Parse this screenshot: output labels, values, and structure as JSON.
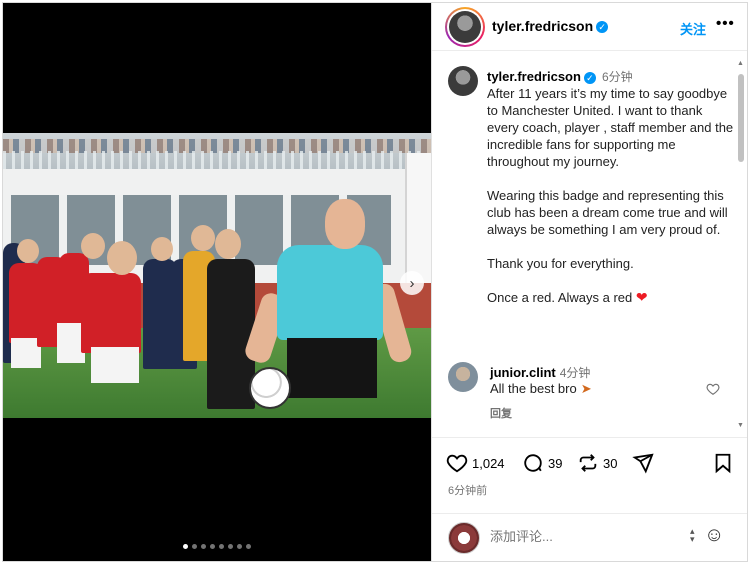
{
  "header": {
    "username": "tyler.fredricson",
    "follow_label": "关注",
    "more_label": "•••"
  },
  "caption": {
    "username": "tyler.fredricson",
    "time": "6分钟",
    "paragraphs": [
      "After 11 years it’s my time to say goodbye to Manchester United. I want to thank every coach, player , staff member and the incredible fans for supporting me throughout my journey.",
      "Wearing this badge and representing this club has been a dream come true and will always be something I am very proud of.",
      "Thank you for everything.",
      "Once a red. Always a red"
    ]
  },
  "comment": {
    "username": "junior.clint",
    "time": "4分钟",
    "text": "All the best bro",
    "reply_label": "回复"
  },
  "actions": {
    "likes": "1,024",
    "comments": "39",
    "reposts": "30",
    "posted_ago": "6分钟前"
  },
  "composer": {
    "placeholder": "添加评论..."
  },
  "carousel": {
    "total": 8,
    "active_index": 0
  },
  "colors": {
    "accent": "#0095f6",
    "heart": "#ed1c24"
  }
}
